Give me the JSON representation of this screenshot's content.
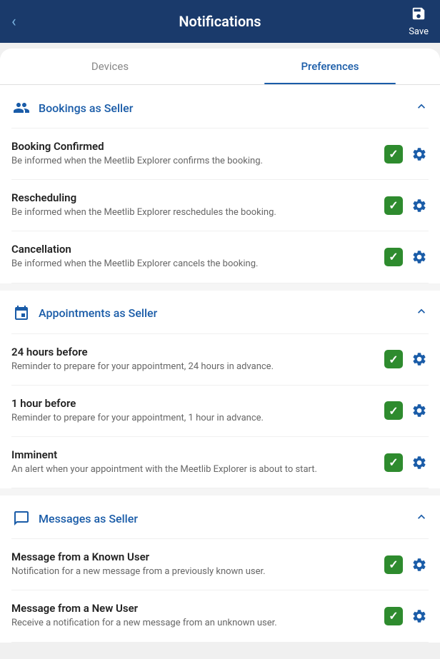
{
  "header": {
    "title": "Notifications",
    "save_label": "Save",
    "back_icon": "‹"
  },
  "tabs": [
    {
      "label": "Devices",
      "active": false
    },
    {
      "label": "Preferences",
      "active": true
    }
  ],
  "sections": [
    {
      "id": "bookings-seller",
      "icon": "bookings",
      "title": "Bookings as Seller",
      "collapsed": false,
      "items": [
        {
          "title": "Booking Confirmed",
          "description": "Be informed when the Meetlib Explorer confirms the booking.",
          "checked": true
        },
        {
          "title": "Rescheduling",
          "description": "Be informed when the Meetlib Explorer reschedules the booking.",
          "checked": true
        },
        {
          "title": "Cancellation",
          "description": "Be informed when the Meetlib Explorer cancels the booking.",
          "checked": true
        }
      ]
    },
    {
      "id": "appointments-seller",
      "icon": "appointments",
      "title": "Appointments as Seller",
      "collapsed": false,
      "items": [
        {
          "title": "24 hours before",
          "description": "Reminder to prepare for your appointment, 24 hours in advance.",
          "checked": true
        },
        {
          "title": "1 hour before",
          "description": "Reminder to prepare for your appointment, 1 hour in advance.",
          "checked": true
        },
        {
          "title": "Imminent",
          "description": "An alert when your appointment with the Meetlib Explorer is about to start.",
          "checked": true
        }
      ]
    },
    {
      "id": "messages-seller",
      "icon": "messages",
      "title": "Messages as Seller",
      "collapsed": false,
      "items": [
        {
          "title": "Message from a Known User",
          "description": "Notification for a new message from a previously known user.",
          "checked": true
        },
        {
          "title": "Message from a New User",
          "description": "Receive a notification for a new message from an unknown user.",
          "checked": true
        }
      ]
    }
  ]
}
